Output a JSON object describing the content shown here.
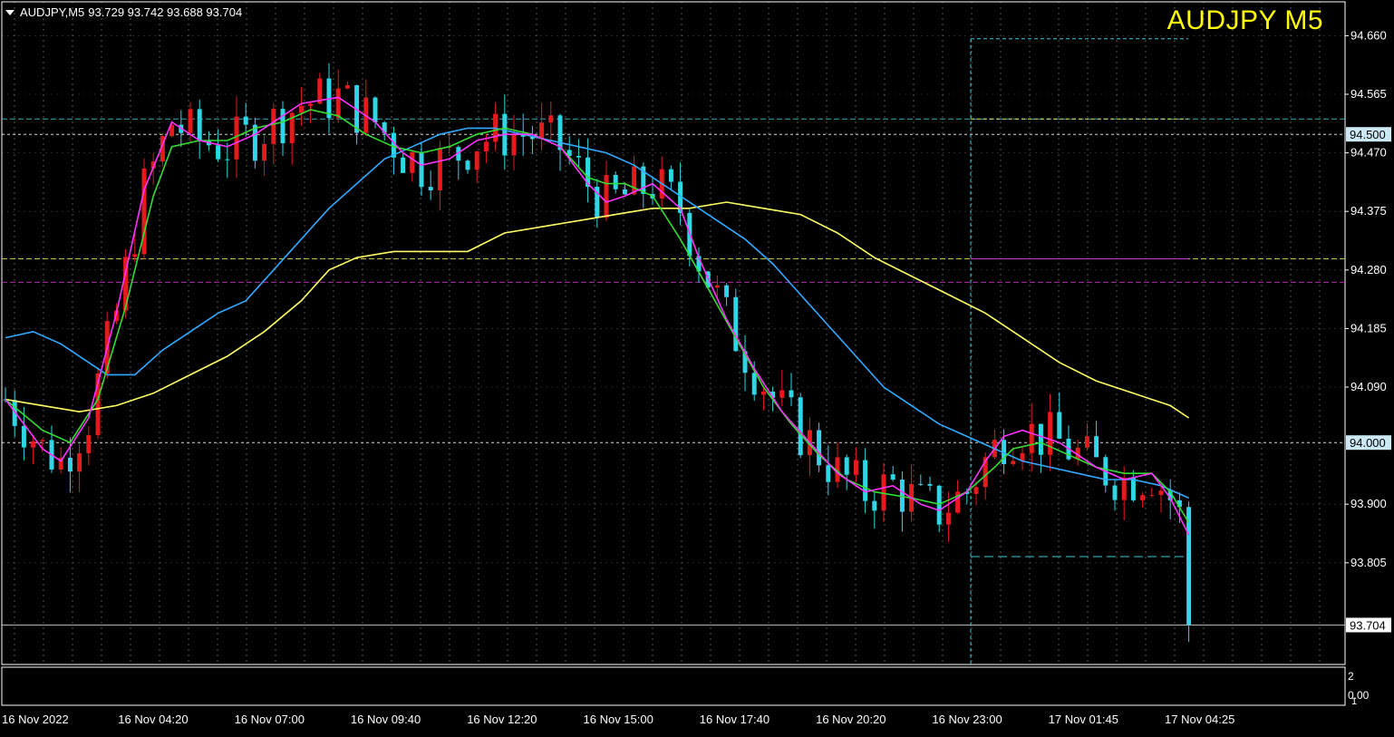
{
  "header": {
    "symbol_tf": "AUDJPY,M5",
    "ohlc": "93.729 93.742 93.688 93.704",
    "big_title": "AUDJPY M5"
  },
  "colors": {
    "background": "#000000",
    "grid": "#c8c8c8",
    "axis": "#ffffff",
    "bull_candle": "#e41a1c",
    "bear_candle": "#2fd7e6",
    "ma_fast": "#ff33ff",
    "ma_mid": "#33dd33",
    "ma_slow": "#33aaff",
    "ma_long": "#ffff66",
    "level_cyan": "#40c8d8",
    "level_yellow": "#e6e64d",
    "level_magenta": "#cc33cc"
  },
  "price_axis": {
    "ticks": [
      "94.660",
      "94.565",
      "94.470",
      "94.375",
      "94.280",
      "94.185",
      "94.090",
      "93.900",
      "93.805"
    ],
    "tick_values": [
      94.66,
      94.565,
      94.47,
      94.375,
      94.28,
      94.185,
      94.09,
      93.9,
      93.805
    ],
    "badges": [
      {
        "label": "94.500",
        "value": 94.5
      },
      {
        "label": "94.000",
        "value": 94.0
      },
      {
        "label": "93.704",
        "value": 93.704
      }
    ],
    "range": [
      93.64,
      94.715
    ]
  },
  "time_axis": {
    "labels": [
      "16 Nov 2022",
      "16 Nov 04:20",
      "16 Nov 07:00",
      "16 Nov 09:40",
      "16 Nov 12:20",
      "16 Nov 15:00",
      "16 Nov 17:40",
      "16 Nov 20:20",
      "16 Nov 23:00",
      "17 Nov 01:45",
      "17 Nov 04:25"
    ]
  },
  "sub_window": {
    "ticks": [
      "2",
      "0.00",
      "1"
    ]
  },
  "chart_data": {
    "type": "candlestick",
    "symbol": "AUDJPY",
    "timeframe": "M5",
    "last_price": 93.704,
    "horizontal_levels": [
      {
        "value": 94.525,
        "style": "dashed",
        "color": "cyan"
      },
      {
        "value": 94.5,
        "style": "dotted",
        "color": "white"
      },
      {
        "value": 94.298,
        "style": "dashed",
        "color": "yellow"
      },
      {
        "value": 94.26,
        "style": "dashed",
        "color": "magenta"
      },
      {
        "value": 94.0,
        "style": "dotted",
        "color": "white"
      },
      {
        "value": 93.704,
        "style": "solid",
        "color": "white"
      }
    ],
    "session_box": {
      "start_time": "16 Nov 23:00",
      "high": 94.655,
      "low": 93.815,
      "mid_yellow": 94.525,
      "mid_magenta": 94.298
    },
    "ma_fast": [
      [
        0,
        94.07
      ],
      [
        4,
        93.99
      ],
      [
        6,
        93.97
      ],
      [
        9,
        94.04
      ],
      [
        12,
        94.21
      ],
      [
        15,
        94.41
      ],
      [
        18,
        94.52
      ],
      [
        21,
        94.49
      ],
      [
        24,
        94.48
      ],
      [
        27,
        94.5
      ],
      [
        30,
        94.53
      ],
      [
        32,
        94.55
      ],
      [
        36,
        94.56
      ],
      [
        40,
        94.52
      ],
      [
        43,
        94.47
      ],
      [
        45,
        94.45
      ],
      [
        48,
        94.46
      ],
      [
        51,
        94.49
      ],
      [
        54,
        94.5
      ],
      [
        57,
        94.5
      ],
      [
        60,
        94.48
      ],
      [
        63,
        94.42
      ],
      [
        65,
        94.39
      ],
      [
        67,
        94.4
      ],
      [
        70,
        94.42
      ],
      [
        73,
        94.38
      ],
      [
        75,
        94.3
      ],
      [
        78,
        94.2
      ],
      [
        81,
        94.12
      ],
      [
        84,
        94.05
      ],
      [
        87,
        94.0
      ],
      [
        90,
        93.95
      ],
      [
        93,
        93.92
      ],
      [
        96,
        93.93
      ],
      [
        99,
        93.9
      ],
      [
        101,
        93.89
      ],
      [
        104,
        93.92
      ],
      [
        106,
        93.97
      ],
      [
        108,
        94.01
      ],
      [
        110,
        94.02
      ],
      [
        112,
        94.01
      ],
      [
        114,
        94.0
      ],
      [
        116,
        93.98
      ],
      [
        118,
        93.96
      ],
      [
        121,
        93.94
      ],
      [
        124,
        93.95
      ],
      [
        126,
        93.91
      ],
      [
        128,
        93.85
      ]
    ],
    "ma_mid": [
      [
        0,
        94.07
      ],
      [
        4,
        94.02
      ],
      [
        7,
        94.0
      ],
      [
        10,
        94.07
      ],
      [
        13,
        94.22
      ],
      [
        16,
        94.4
      ],
      [
        18,
        94.48
      ],
      [
        21,
        94.49
      ],
      [
        24,
        94.49
      ],
      [
        27,
        94.51
      ],
      [
        30,
        94.52
      ],
      [
        33,
        94.54
      ],
      [
        36,
        94.53
      ],
      [
        39,
        94.5
      ],
      [
        42,
        94.48
      ],
      [
        45,
        94.47
      ],
      [
        48,
        94.48
      ],
      [
        51,
        94.5
      ],
      [
        54,
        94.51
      ],
      [
        57,
        94.5
      ],
      [
        60,
        94.48
      ],
      [
        63,
        94.43
      ],
      [
        65,
        94.42
      ],
      [
        67,
        94.42
      ],
      [
        70,
        94.4
      ],
      [
        73,
        94.33
      ],
      [
        76,
        94.25
      ],
      [
        79,
        94.17
      ],
      [
        82,
        94.09
      ],
      [
        85,
        94.03
      ],
      [
        88,
        93.98
      ],
      [
        91,
        93.94
      ],
      [
        94,
        93.92
      ],
      [
        98,
        93.91
      ],
      [
        101,
        93.9
      ],
      [
        104,
        93.92
      ],
      [
        107,
        93.96
      ],
      [
        109,
        93.99
      ],
      [
        112,
        94.0
      ],
      [
        115,
        93.98
      ],
      [
        118,
        93.96
      ],
      [
        121,
        93.95
      ],
      [
        124,
        93.95
      ],
      [
        126,
        93.92
      ],
      [
        128,
        93.87
      ]
    ],
    "ma_slow": [
      [
        0,
        94.17
      ],
      [
        3,
        94.18
      ],
      [
        6,
        94.16
      ],
      [
        9,
        94.13
      ],
      [
        11,
        94.11
      ],
      [
        14,
        94.11
      ],
      [
        17,
        94.15
      ],
      [
        20,
        94.18
      ],
      [
        23,
        94.21
      ],
      [
        26,
        94.23
      ],
      [
        29,
        94.28
      ],
      [
        32,
        94.33
      ],
      [
        35,
        94.38
      ],
      [
        38,
        94.42
      ],
      [
        41,
        94.46
      ],
      [
        44,
        94.48
      ],
      [
        47,
        94.5
      ],
      [
        50,
        94.51
      ],
      [
        53,
        94.51
      ],
      [
        56,
        94.5
      ],
      [
        59,
        94.49
      ],
      [
        62,
        94.48
      ],
      [
        65,
        94.47
      ],
      [
        68,
        94.45
      ],
      [
        71,
        94.42
      ],
      [
        74,
        94.39
      ],
      [
        77,
        94.36
      ],
      [
        80,
        94.33
      ],
      [
        83,
        94.29
      ],
      [
        86,
        94.24
      ],
      [
        89,
        94.19
      ],
      [
        92,
        94.14
      ],
      [
        95,
        94.09
      ],
      [
        98,
        94.06
      ],
      [
        101,
        94.03
      ],
      [
        104,
        94.01
      ],
      [
        107,
        93.99
      ],
      [
        110,
        93.97
      ],
      [
        113,
        93.96
      ],
      [
        116,
        93.95
      ],
      [
        119,
        93.94
      ],
      [
        122,
        93.94
      ],
      [
        125,
        93.93
      ],
      [
        128,
        93.91
      ]
    ],
    "ma_long": [
      [
        0,
        94.07
      ],
      [
        4,
        94.06
      ],
      [
        8,
        94.05
      ],
      [
        12,
        94.06
      ],
      [
        16,
        94.08
      ],
      [
        20,
        94.11
      ],
      [
        24,
        94.14
      ],
      [
        28,
        94.18
      ],
      [
        32,
        94.23
      ],
      [
        35,
        94.28
      ],
      [
        38,
        94.3
      ],
      [
        42,
        94.31
      ],
      [
        46,
        94.31
      ],
      [
        50,
        94.31
      ],
      [
        54,
        94.34
      ],
      [
        58,
        94.35
      ],
      [
        62,
        94.36
      ],
      [
        66,
        94.37
      ],
      [
        70,
        94.38
      ],
      [
        74,
        94.38
      ],
      [
        78,
        94.39
      ],
      [
        82,
        94.38
      ],
      [
        86,
        94.37
      ],
      [
        90,
        94.34
      ],
      [
        94,
        94.3
      ],
      [
        98,
        94.27
      ],
      [
        102,
        94.24
      ],
      [
        106,
        94.21
      ],
      [
        110,
        94.17
      ],
      [
        114,
        94.13
      ],
      [
        118,
        94.1
      ],
      [
        122,
        94.08
      ],
      [
        126,
        94.06
      ],
      [
        128,
        94.04
      ]
    ]
  }
}
